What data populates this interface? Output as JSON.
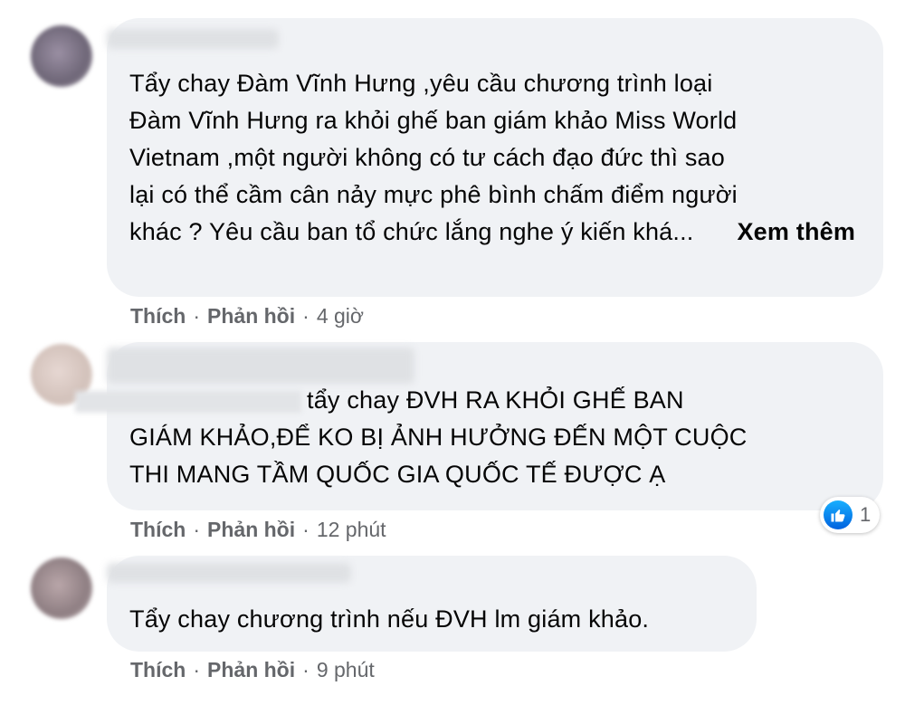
{
  "comments": [
    {
      "text_lines": [
        "Tẩy chay Đàm Vĩnh Hưng ,yêu cầu chương trình loại",
        "Đàm Vĩnh Hưng ra khỏi ghế ban giám khảo Miss World",
        "Vietnam ,một người không có tư cách đạo đức thì sao",
        "lại có thể cầm cân nảy mực phê bình chấm điểm người",
        "khác ? Yêu cầu ban tổ chức lắng nghe ý kiến khá..."
      ],
      "see_more": "Xem thêm",
      "like_label": "Thích",
      "reply_label": "Phản hồi",
      "time": "4 giờ"
    },
    {
      "text_lines": [
        "tẩy chay ĐVH RA KHỎI GHẾ BAN",
        "GIÁM KHẢO,ĐỂ KO BỊ ẢNH HƯỞNG ĐẾN MỘT CUỘC",
        "THI MANG TẦM QUỐC GIA QUỐC TẾ ĐƯỢC Ạ"
      ],
      "like_label": "Thích",
      "reply_label": "Phản hồi",
      "time": "12 phút",
      "reaction_count": "1",
      "reaction_icon": "thumbs-up-icon"
    },
    {
      "text_lines": [
        "Tẩy chay chương trình nếu ĐVH lm giám khảo."
      ],
      "like_label": "Thích",
      "reply_label": "Phản hồi",
      "time": "9 phút"
    }
  ],
  "separator": "·",
  "colors": {
    "bubble": "#f0f2f5",
    "meta": "#65676b",
    "like_blue": "#1877f2"
  }
}
